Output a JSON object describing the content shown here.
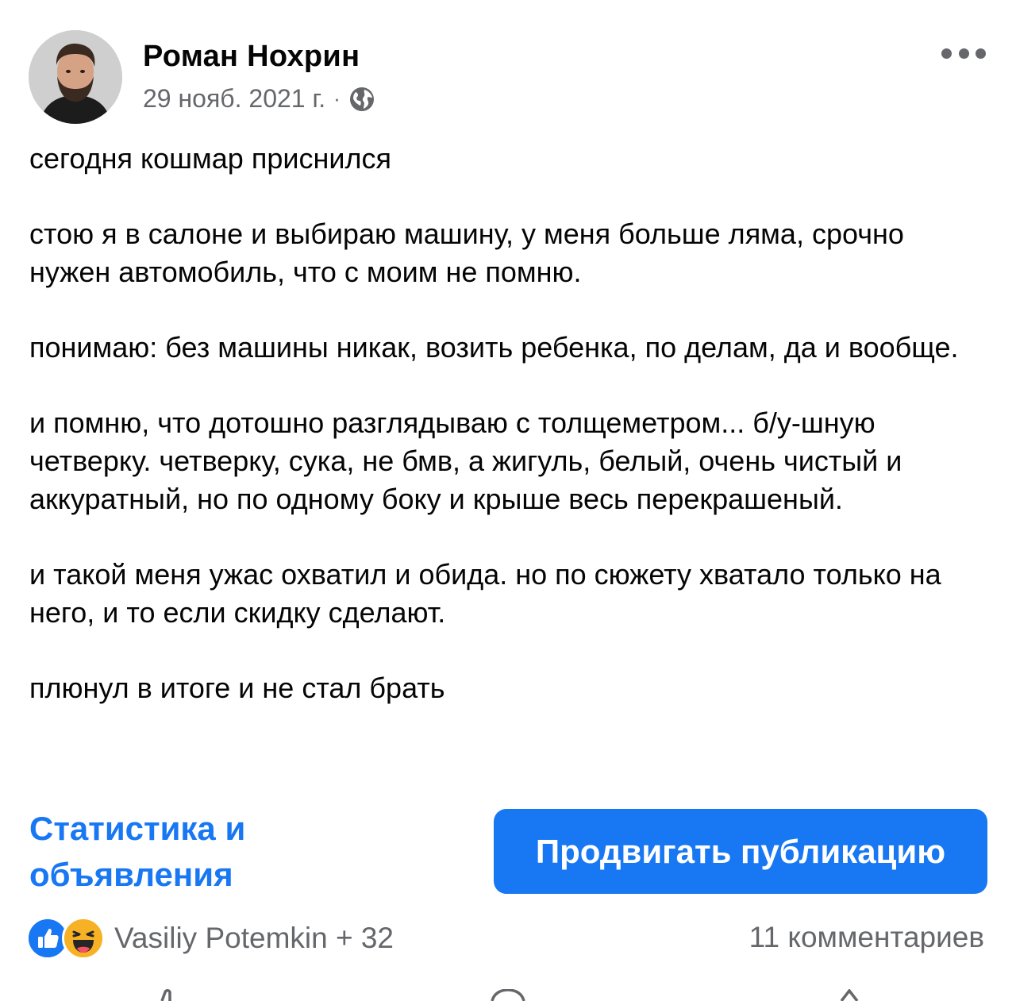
{
  "post": {
    "author": "Роман Нохрин",
    "date": "29 нояб. 2021 г.",
    "separator": "·",
    "privacy_icon": "globe-icon",
    "paragraphs": [
      "сегодня кошмар приснился",
      "стою я в салоне и выбираю машину, у меня больше ляма, срочно нужен автомобиль, что с моим не помню.",
      "понимаю: без машины никак, возить ребенка, по делам, да и вообще.",
      "и помню, что дотошно разглядываю с толщеметром... б/у-шную четверку. четверку, сука, не бмв, а жигуль, белый, очень чистый и аккуратный, но по одному боку и крыше весь перекрашеный.",
      "и такой меня ужас охватил и обида. но по сюжету хватало только на него, и то если скидку сделают.",
      "плюнул в итоге и не стал брать"
    ]
  },
  "actions": {
    "stats_link": "Статистика и объявления",
    "promote_button": "Продвигать публикацию"
  },
  "engagement": {
    "reaction_icons": [
      "like-icon",
      "haha-icon"
    ],
    "reactions_text": "Vasiliy Potemkin + 32",
    "comments_text": "11 комментариев"
  },
  "colors": {
    "accent": "#1877f2",
    "secondary_text": "#65676b",
    "text": "#050505"
  }
}
